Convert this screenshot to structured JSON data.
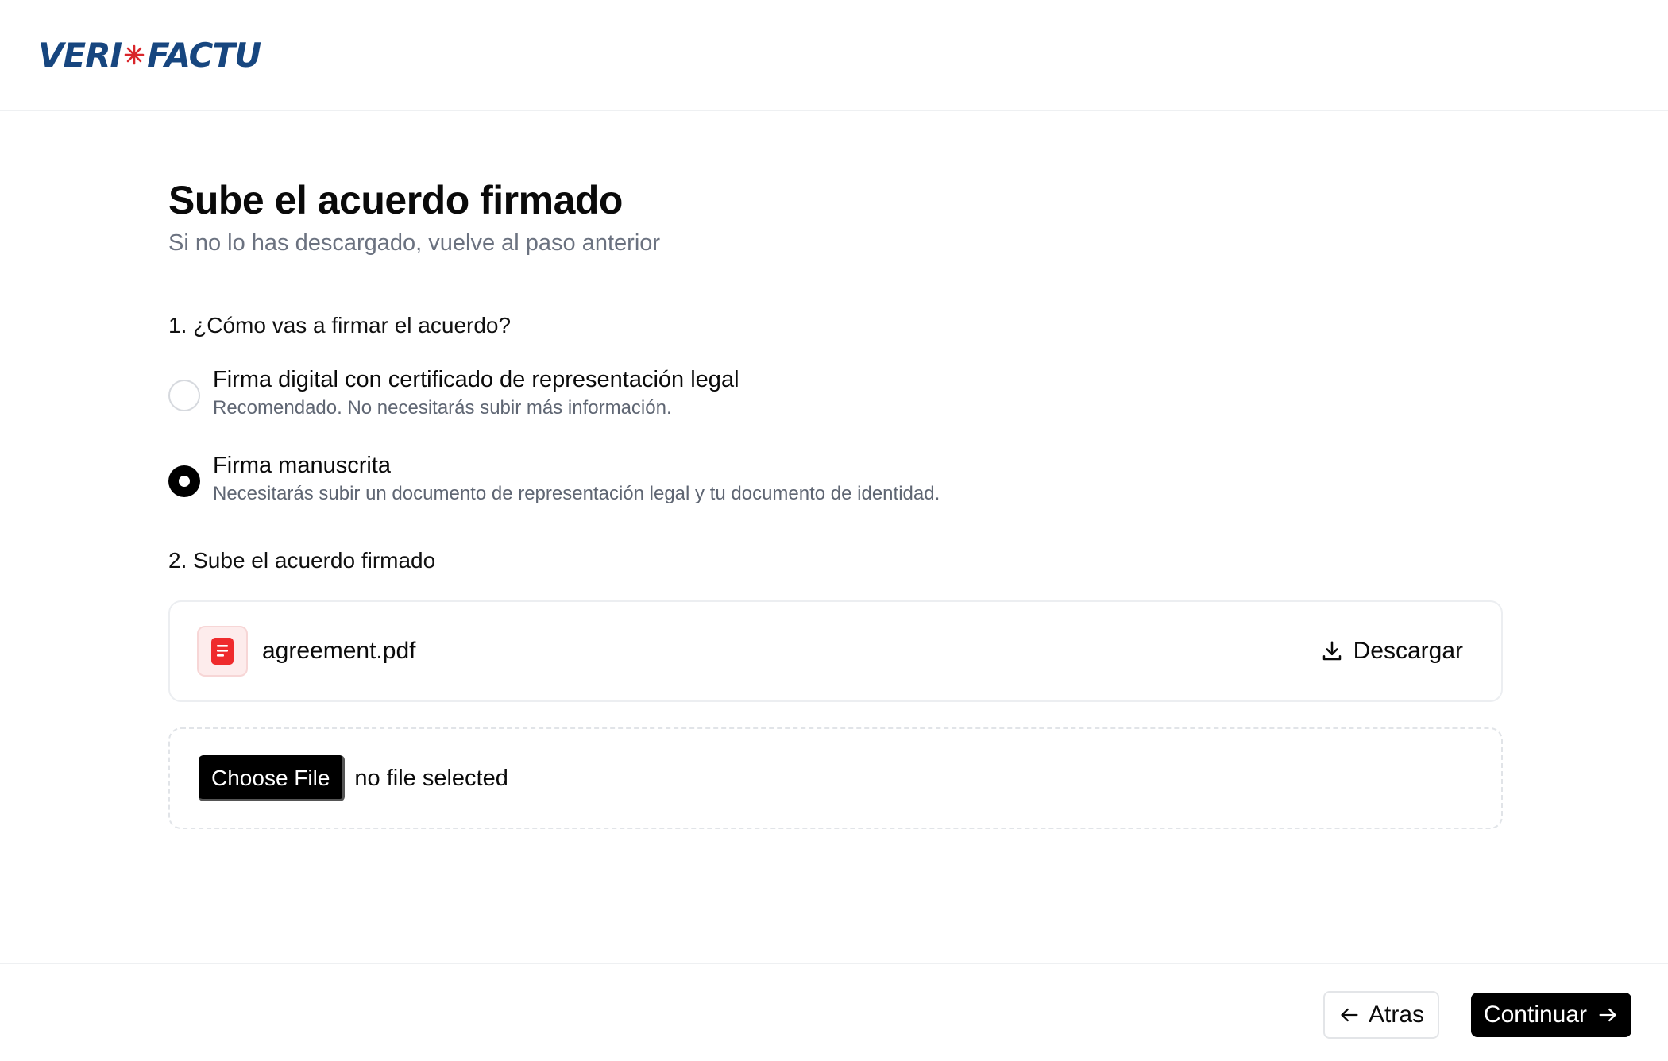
{
  "header": {
    "logo_left": "VERI",
    "logo_star": "*",
    "logo_right": "FACTU"
  },
  "page": {
    "title": "Sube el acuerdo firmado",
    "subtitle": "Si no lo has descargado, vuelve al paso anterior"
  },
  "question1": {
    "heading": "1. ¿Cómo vas a firmar el acuerdo?",
    "options": [
      {
        "title": "Firma digital con certificado de representación legal",
        "description": "Recomendado. No necesitarás subir más información.",
        "selected": false
      },
      {
        "title": "Firma manuscrita",
        "description": "Necesitarás subir un documento de representación legal y tu documento de identidad.",
        "selected": true
      }
    ]
  },
  "question2": {
    "heading": "2. Sube el acuerdo firmado",
    "file": {
      "name": "agreement.pdf",
      "icon": "pdf-document-icon",
      "download_label": "Descargar"
    },
    "upload": {
      "button_label": "Choose File",
      "status": "no file selected"
    }
  },
  "footer": {
    "back_label": "Atras",
    "next_label": "Continuar"
  },
  "colors": {
    "brand_blue": "#17467f",
    "brand_red": "#d9262b",
    "primary_button": "#000000",
    "file_icon_red": "#ef2b2d"
  }
}
